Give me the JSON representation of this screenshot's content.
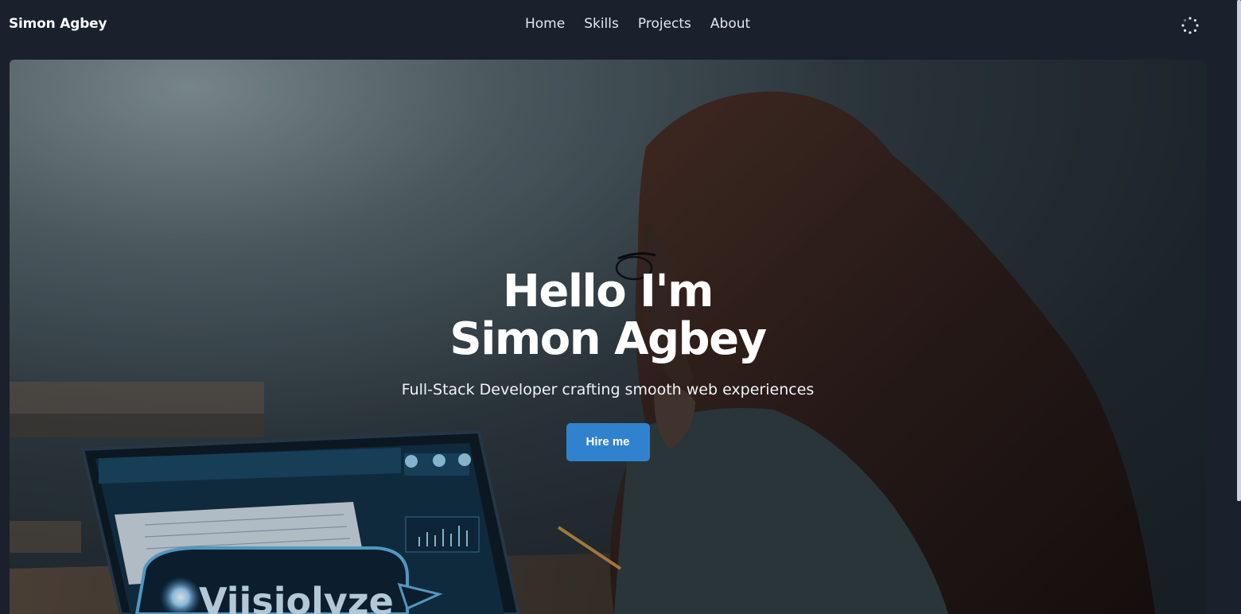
{
  "brand": {
    "name": "Simon Agbey"
  },
  "nav": {
    "links": [
      "Home",
      "Skills",
      "Projects",
      "About"
    ]
  },
  "theme_toggle": {
    "icon": "spinner-dots-icon"
  },
  "hero": {
    "title_line1": "Hello I'm",
    "title_line2": "Simon Agbey",
    "subtitle": "Full-Stack Developer crafting smooth web experiences",
    "cta_label": "Hire me",
    "laptop_screen_text": "Viisiolyze"
  },
  "colors": {
    "background": "#1a202c",
    "accent": "#3182ce",
    "text": "#ffffff"
  }
}
